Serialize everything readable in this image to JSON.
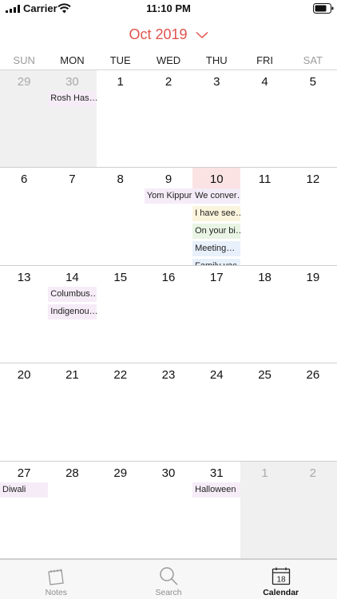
{
  "status_bar": {
    "carrier": "Carrier",
    "time": "11:10 PM"
  },
  "header": {
    "month_title": "Oct 2019"
  },
  "weekdays": [
    "SUN",
    "MON",
    "TUE",
    "WED",
    "THU",
    "FRI",
    "SAT"
  ],
  "weeks": [
    [
      {
        "day": "29",
        "other": true,
        "events": []
      },
      {
        "day": "30",
        "other": true,
        "events": [
          {
            "text": "Rosh Has…",
            "color": "#f6ecf8"
          }
        ]
      },
      {
        "day": "1",
        "events": []
      },
      {
        "day": "2",
        "events": []
      },
      {
        "day": "3",
        "events": []
      },
      {
        "day": "4",
        "events": []
      },
      {
        "day": "5",
        "events": []
      }
    ],
    [
      {
        "day": "6",
        "events": []
      },
      {
        "day": "7",
        "events": []
      },
      {
        "day": "8",
        "events": []
      },
      {
        "day": "9",
        "events": [
          {
            "text": "Yom Kippur",
            "color": "#f6ecf8"
          }
        ]
      },
      {
        "day": "10",
        "today": true,
        "events": [
          {
            "text": "We conver…",
            "color": "#f3ecf8"
          },
          {
            "text": "I have see…",
            "color": "#fbf4dc"
          },
          {
            "text": "On your bi…",
            "color": "#e9f4e4"
          },
          {
            "text": "Meeting…",
            "color": "#e7f0fb"
          },
          {
            "text": "Family vac…",
            "color": "#e7f0fb"
          }
        ]
      },
      {
        "day": "11",
        "events": []
      },
      {
        "day": "12",
        "events": []
      }
    ],
    [
      {
        "day": "13",
        "events": []
      },
      {
        "day": "14",
        "events": [
          {
            "text": "Columbus…",
            "color": "#f6ecf8"
          },
          {
            "text": "Indigenou…",
            "color": "#f6ecf8"
          }
        ]
      },
      {
        "day": "15",
        "events": []
      },
      {
        "day": "16",
        "events": []
      },
      {
        "day": "17",
        "events": []
      },
      {
        "day": "18",
        "events": []
      },
      {
        "day": "19",
        "events": []
      }
    ],
    [
      {
        "day": "20",
        "events": []
      },
      {
        "day": "21",
        "events": []
      },
      {
        "day": "22",
        "events": []
      },
      {
        "day": "23",
        "events": []
      },
      {
        "day": "24",
        "events": []
      },
      {
        "day": "25",
        "events": []
      },
      {
        "day": "26",
        "events": []
      }
    ],
    [
      {
        "day": "27",
        "events": [
          {
            "text": "Diwali",
            "color": "#f6ecf8"
          }
        ]
      },
      {
        "day": "28",
        "events": []
      },
      {
        "day": "29",
        "events": []
      },
      {
        "day": "30",
        "events": []
      },
      {
        "day": "31",
        "events": [
          {
            "text": "Halloween",
            "color": "#f6ecf8"
          }
        ]
      },
      {
        "day": "1",
        "other": true,
        "events": []
      },
      {
        "day": "2",
        "other": true,
        "events": []
      }
    ]
  ],
  "tabs": [
    {
      "label": "Notes",
      "icon": "notes-icon",
      "active": false
    },
    {
      "label": "Search",
      "icon": "search-icon",
      "active": false
    },
    {
      "label": "Calendar",
      "icon": "calendar-icon",
      "calendar_day": "18",
      "active": true
    }
  ],
  "colors": {
    "accent": "#e0534d",
    "today_highlight": "#fbe3e3",
    "other_month_bg": "#f0f0f0"
  }
}
